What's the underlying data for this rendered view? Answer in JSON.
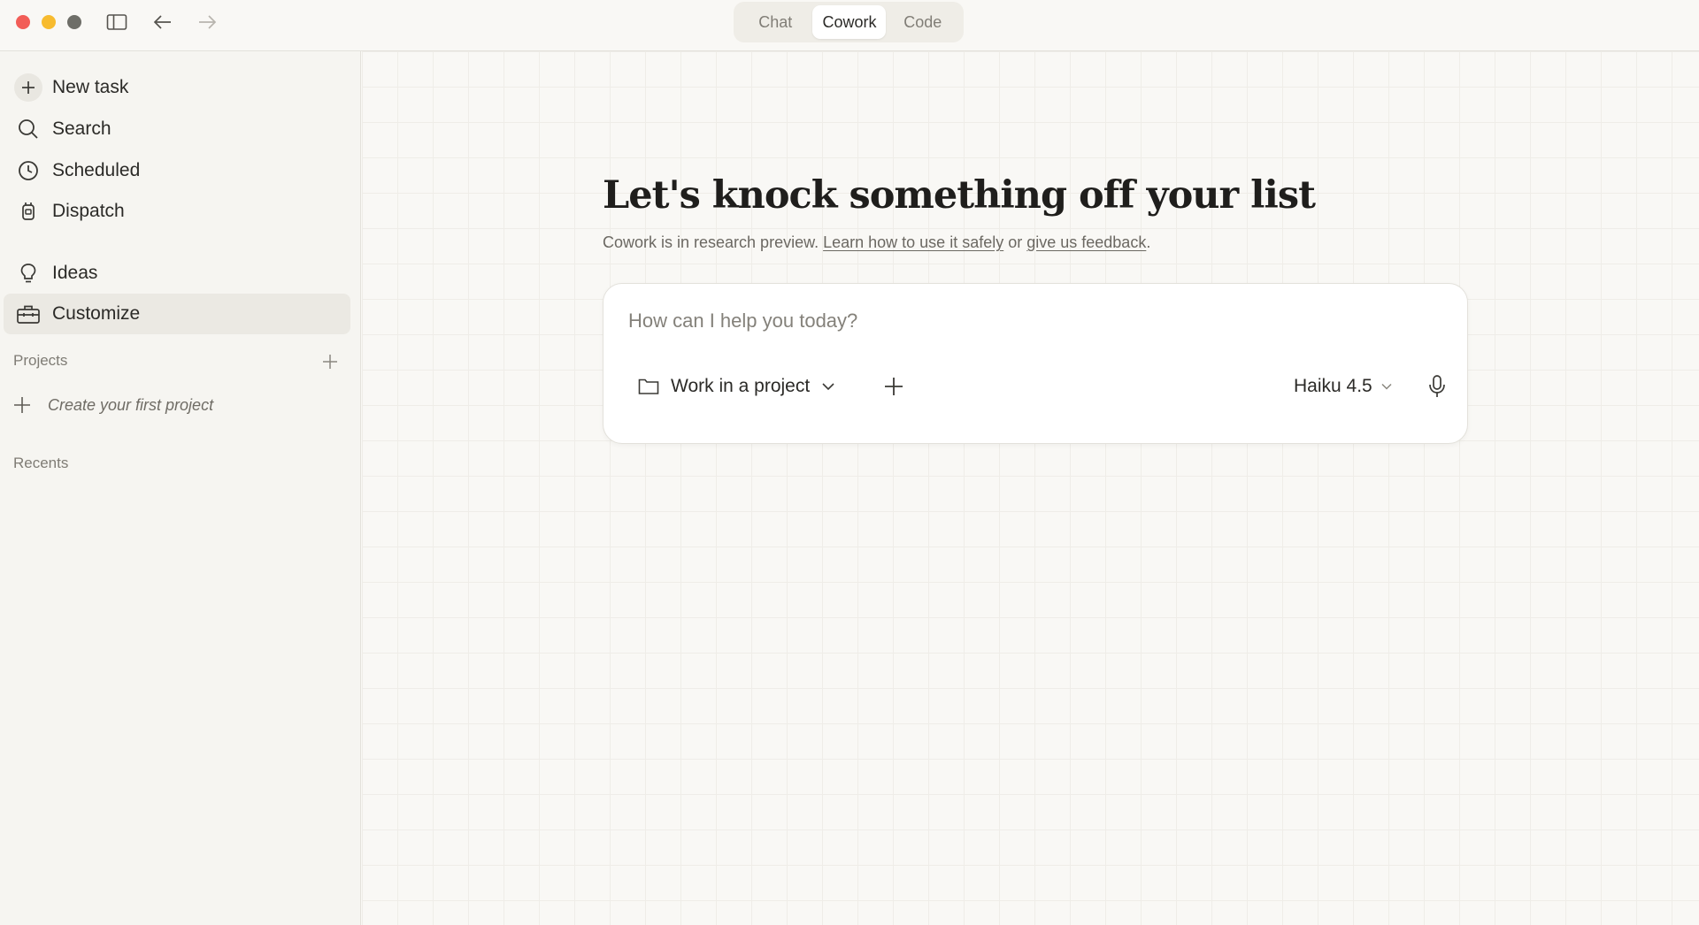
{
  "window": {
    "controls": [
      "close",
      "minimize",
      "maximize"
    ]
  },
  "toolbar": {
    "sidebar_toggle_icon": "sidebar-icon",
    "back_icon": "arrow-left-icon",
    "forward_icon": "arrow-right-icon"
  },
  "mode_tabs": [
    {
      "label": "Chat",
      "active": false
    },
    {
      "label": "Cowork",
      "active": true
    },
    {
      "label": "Code",
      "active": false
    }
  ],
  "sidebar": {
    "items": [
      {
        "label": "New task",
        "icon": "plus-icon"
      },
      {
        "label": "Search",
        "icon": "search-icon"
      },
      {
        "label": "Scheduled",
        "icon": "clock-icon"
      },
      {
        "label": "Dispatch",
        "icon": "dispatch-icon"
      },
      {
        "label": "Ideas",
        "icon": "lightbulb-icon"
      },
      {
        "label": "Customize",
        "icon": "toolbox-icon",
        "active": true
      }
    ],
    "projects_label": "Projects",
    "create_project_label": "Create your first project",
    "recents_label": "Recents"
  },
  "main": {
    "headline": "Let's knock something off your list",
    "subline": {
      "prefix": "Cowork is in research preview. ",
      "link1": "Learn how to use it safely",
      "middle": " or ",
      "link2": "give us feedback",
      "suffix": "."
    },
    "composer": {
      "placeholder": "How can I help you today?",
      "value": "",
      "project_button_label": "Work in a project",
      "model_label": "Haiku 4.5"
    }
  },
  "colors": {
    "background": "#f9f8f5",
    "sidebar_bg": "#f6f5f1",
    "active_item_bg": "#ebe9e3",
    "close": "#f25d57",
    "minimize": "#f7bb2f",
    "maximize": "#6e6e68"
  }
}
